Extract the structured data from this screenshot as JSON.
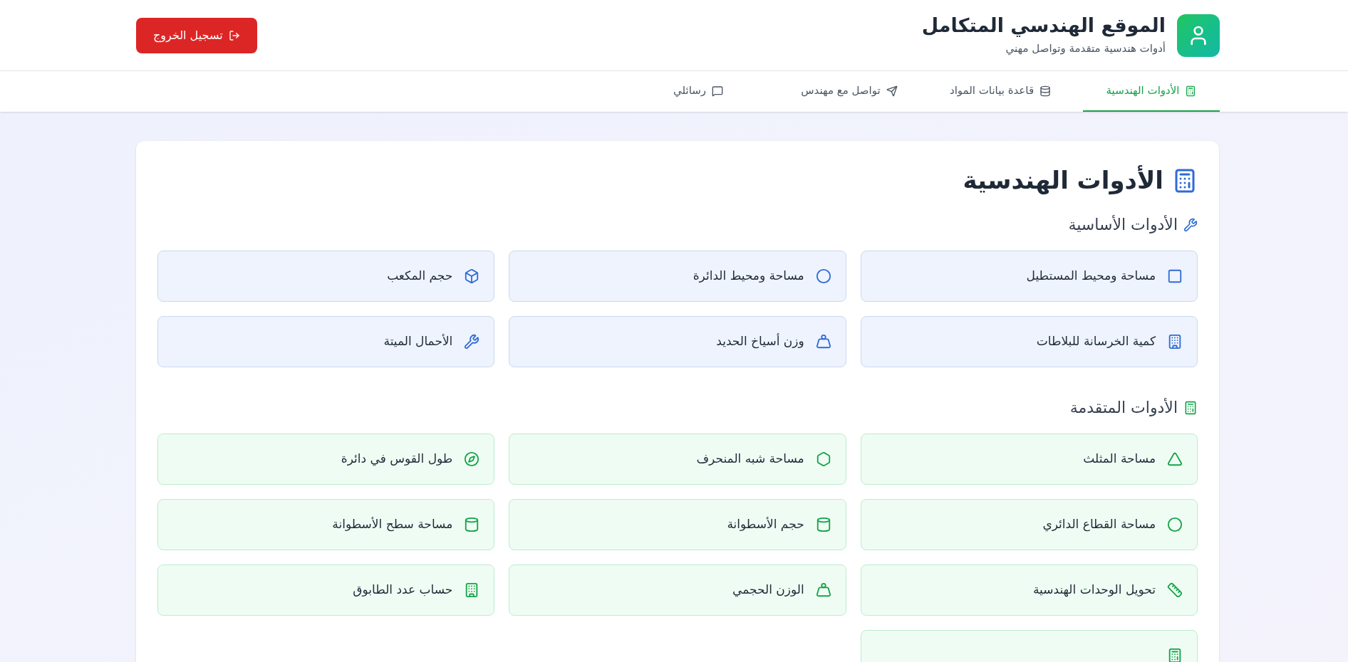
{
  "header": {
    "title": "الموقع الهندسي المتكامل",
    "subtitle": "أدوات هندسية متقدمة وتواصل مهني",
    "logout": "تسجيل الخروج"
  },
  "tabs": [
    {
      "label": "الأدوات الهندسية",
      "kind": "calculator",
      "selected": true
    },
    {
      "label": "قاعدة بيانات المواد",
      "kind": "database",
      "selected": false
    },
    {
      "label": "تواصل مع مهندس",
      "kind": "send",
      "selected": false
    },
    {
      "label": "رسائلي",
      "kind": "message",
      "selected": false
    }
  ],
  "panel": {
    "title": "الأدوات الهندسية",
    "sections": [
      {
        "title": "الأدوات الأساسية",
        "kind": "basic",
        "tools": [
          {
            "label": "مساحة ومحيط المستطيل",
            "kind": "square"
          },
          {
            "label": "مساحة ومحيط الدائرة",
            "kind": "circle"
          },
          {
            "label": "حجم المكعب",
            "kind": "box"
          },
          {
            "label": "كمية الخرسانة للبلاطات",
            "kind": "building"
          },
          {
            "label": "وزن أسياخ الحديد",
            "kind": "weight"
          },
          {
            "label": "الأحمال الميتة",
            "kind": "wrench"
          }
        ]
      },
      {
        "title": "الأدوات المتقدمة",
        "kind": "advanced",
        "tools": [
          {
            "label": "مساحة المثلث",
            "kind": "triangle"
          },
          {
            "label": "مساحة شبه المنحرف",
            "kind": "hexagon"
          },
          {
            "label": "طول القوس في دائرة",
            "kind": "compass"
          },
          {
            "label": "مساحة القطاع الدائري",
            "kind": "circle"
          },
          {
            "label": "حجم الأسطوانة",
            "kind": "cylinder"
          },
          {
            "label": "مساحة سطح الأسطوانة",
            "kind": "cylinder"
          },
          {
            "label": "تحويل الوحدات الهندسية",
            "kind": "ruler"
          },
          {
            "label": "الوزن الحجمي",
            "kind": "weight"
          },
          {
            "label": "حساب عدد الطابوق",
            "kind": "building"
          },
          {
            "kind": "calculator"
          }
        ]
      }
    ]
  }
}
